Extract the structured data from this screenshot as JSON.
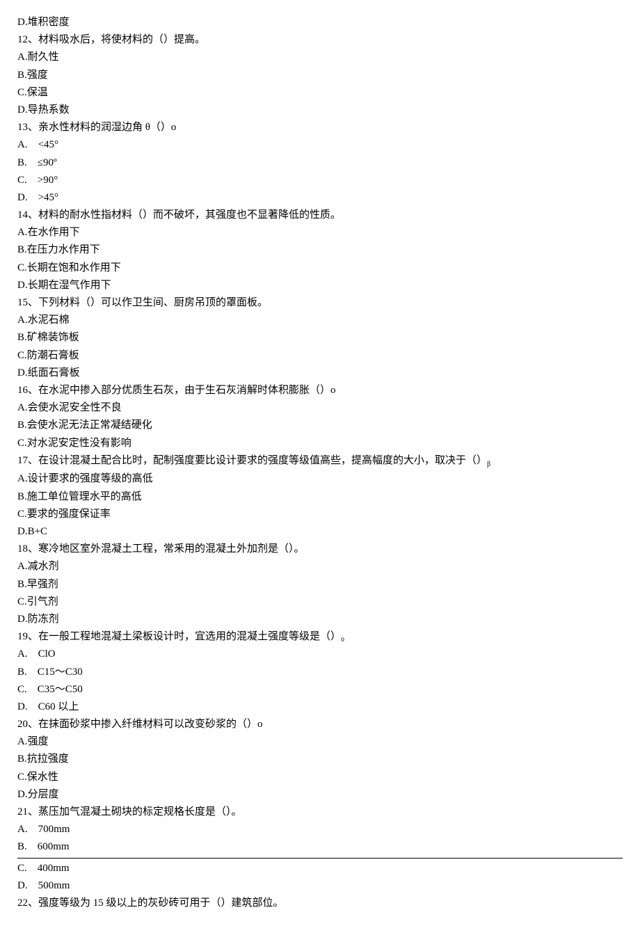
{
  "lines": [
    "D.堆积密度",
    "12、材料吸水后，将使材料的（）提高。",
    "A.耐久性",
    "B.强度",
    "C.保温",
    "D.导热系数",
    "13、亲水性材料的润湿边角 θ（）o",
    "A.    <45°",
    "B.    ≤90º",
    "C.    >90°",
    "D.    >45°",
    "14、材料的耐水性指材料（）而不破坏，其强度也不显著降低的性质。",
    "A.在水作用下",
    "B.在压力水作用下",
    "C.长期在饱和水作用下",
    "D.长期在湿气作用下",
    "15、下列材料（）可以作卫生间、厨房吊顶的罩面板。",
    "A.水泥石棉",
    "B.矿棉装饰板",
    "C.防潮石膏板",
    "D.纸面石膏板",
    "16、在水泥中掺入部分优质生石灰，由于生石灰消解时体积膨胀（）o",
    "A.会使水泥安全性不良",
    "B.会使水泥无法正常凝结硬化",
    "C.对水泥安定性没有影响",
    "17、在设计混凝土配合比时，配制强度要比设计要求的强度等级值高些，提高幅度的大小，取决于（）",
    "A.设计要求的强度等级的高低",
    "B.施工单位管理水平的高低",
    "C.要求的强度保证率",
    "D.B+C",
    "18、寒冷地区室外混凝土工程，常釆用的混凝土外加剂是（）。",
    "A.减水剂",
    "B.早强剂",
    "C.引气剂",
    "D.防冻剂",
    "19、在一般工程地混凝土梁板设计时，宜选用的混凝土强度等级是（）₀",
    "A.    ClO",
    "B.    C15～C30",
    "C.    C35～C50",
    "D.    C60 以上",
    "20、在抹面砂浆中掺入纤维材料可以改变砂浆的（）o",
    "A.强度",
    "B.抗拉强度",
    "C.保水性",
    "D.分层度",
    "21、蒸压加气混凝土砌块的标定规格长度是（）。",
    "A.    700mm",
    "B.    600mm",
    "___HR___",
    "C.    400mm",
    "D.    500mm",
    "22、强度等级为 15 级以上的灰砂砖可用于（）建筑部位。"
  ],
  "special_line_26_suffix": "β"
}
